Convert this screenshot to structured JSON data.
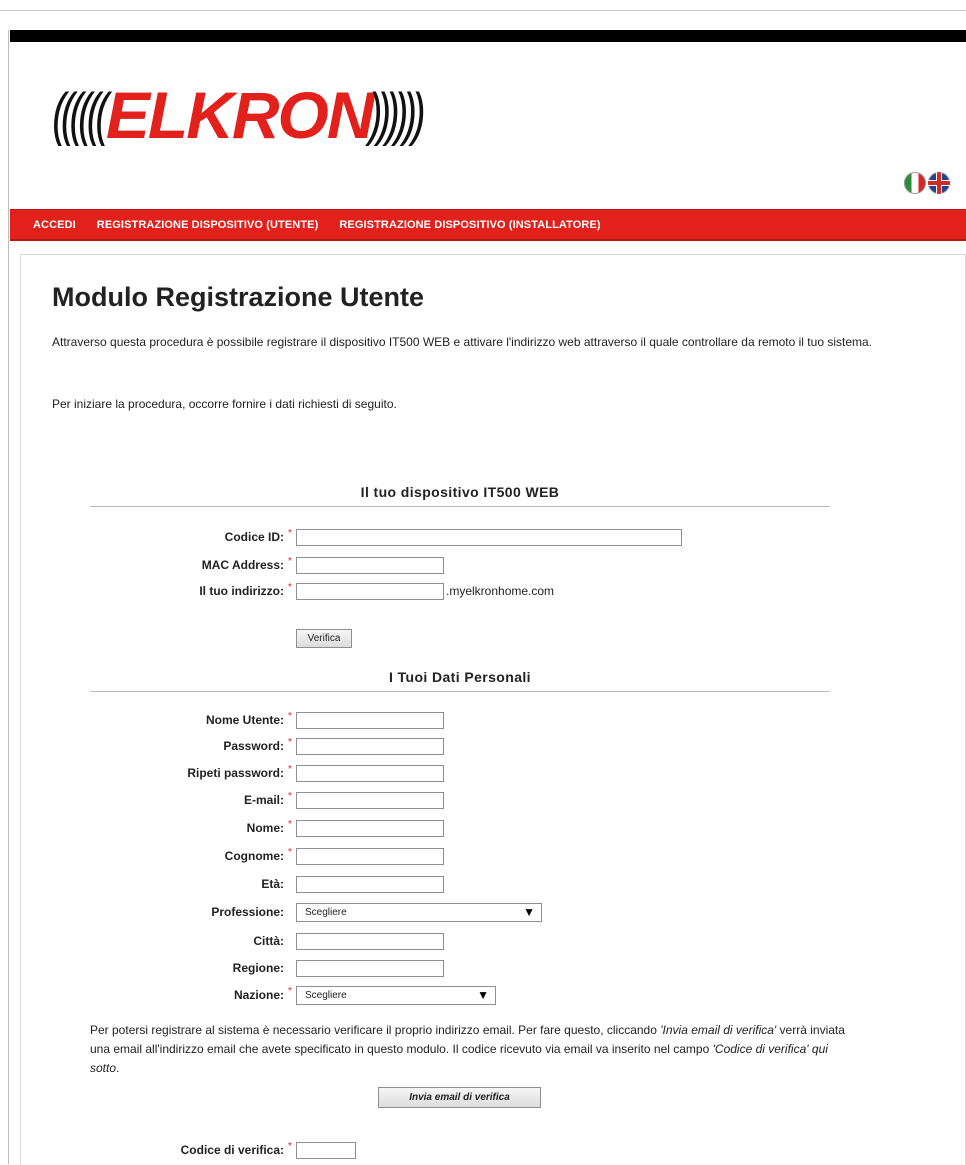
{
  "logo": {
    "left_slashes": "((((((",
    "word": "ELKRON",
    "right_slashes": "))))))"
  },
  "languages": [
    {
      "name": "Italiano",
      "icon": "italy-flag-icon"
    },
    {
      "name": "English",
      "icon": "uk-flag-icon"
    }
  ],
  "nav": {
    "items": [
      {
        "label": "ACCEDI"
      },
      {
        "label": "REGISTRAZIONE DISPOSITIVO (UTENTE)"
      },
      {
        "label": "REGISTRAZIONE DISPOSITIVO (INSTALLATORE)"
      }
    ]
  },
  "page": {
    "title": "Modulo Registrazione Utente",
    "intro": "Attraverso questa procedura è possibile registrare il dispositivo IT500 WEB e attivare l'indirizzo web attraverso il quale controllare da remoto il tuo sistema.",
    "intro2": "Per iniziare la procedura, occorre fornire i dati richiesti di seguito."
  },
  "device_section": {
    "heading": "Il tuo dispositivo IT500 WEB",
    "fields": [
      {
        "label": "Codice ID:",
        "required": "*",
        "value": "",
        "placeholder": ""
      },
      {
        "label": "MAC Address:",
        "required": "*",
        "value": "",
        "placeholder": ""
      },
      {
        "label": "Il tuo indirizzo:",
        "required": "*",
        "value": "",
        "placeholder": "",
        "suffix": ".myelkronhome.com"
      }
    ],
    "verify_button": "Verifica"
  },
  "personal_section": {
    "heading": "I Tuoi Dati Personali",
    "fields": [
      {
        "label": "Nome Utente:",
        "required": "*",
        "value": ""
      },
      {
        "label": "Password:",
        "required": "*",
        "value": ""
      },
      {
        "label": "Ripeti password:",
        "required": "*",
        "value": ""
      },
      {
        "label": "E-mail:",
        "required": "*",
        "value": ""
      },
      {
        "label": "Nome:",
        "required": "*",
        "value": ""
      },
      {
        "label": "Cognome:",
        "required": "*",
        "value": ""
      },
      {
        "label": "Età:",
        "required": "",
        "value": ""
      },
      {
        "label": "Professione:",
        "required": "",
        "selected": "Scegliere"
      },
      {
        "label": "Città:",
        "required": "",
        "value": ""
      },
      {
        "label": "Regione:",
        "required": "",
        "value": ""
      },
      {
        "label": "Nazione:",
        "required": "*",
        "selected": "Scegliere"
      }
    ]
  },
  "verification": {
    "note_before": "Per potersi registrare al sistema è necessario verificare il proprio indirizzo email. Per fare questo, cliccando ",
    "note_link1": "'Invia email di verifica'",
    "note_middle": " verrà inviata una email all'indirizzo email che avete specificato in questo modulo. Il codice ricevuto via email va inserito nel campo ",
    "note_link2": "'Codice di verifica' qui sotto",
    "note_after": ".",
    "send_button": "Invia email di verifica",
    "code_label": "Codice di verifica:",
    "code_required": "*",
    "code_value": ""
  }
}
